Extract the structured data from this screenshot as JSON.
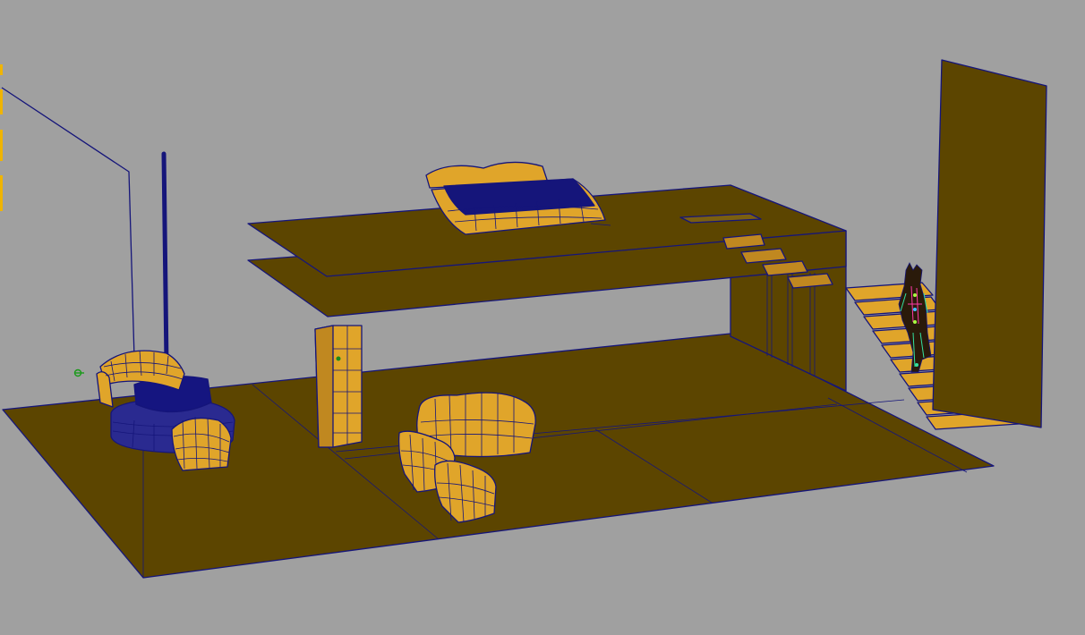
{
  "viewport": {
    "background": "#a0a0a0",
    "wire_color": "#15157a",
    "surface_color": "#5c4500",
    "selected_surface_color": "#e0a52a",
    "edge_marker_color": "#f0b400"
  },
  "scene_objects": [
    {
      "name": "ground-floor-slab"
    },
    {
      "name": "upper-floor-slab"
    },
    {
      "name": "back-wall"
    },
    {
      "name": "left-glass-wall"
    },
    {
      "name": "lamp-pole"
    },
    {
      "name": "round-ottoman"
    },
    {
      "name": "armchair-left-back"
    },
    {
      "name": "armchair-left-front"
    },
    {
      "name": "wardrobe"
    },
    {
      "name": "sofa"
    },
    {
      "name": "armchair-center"
    },
    {
      "name": "armchair-center-front"
    },
    {
      "name": "bed"
    },
    {
      "name": "staircase"
    },
    {
      "name": "tall-partition-wall"
    },
    {
      "name": "character-rig"
    }
  ]
}
